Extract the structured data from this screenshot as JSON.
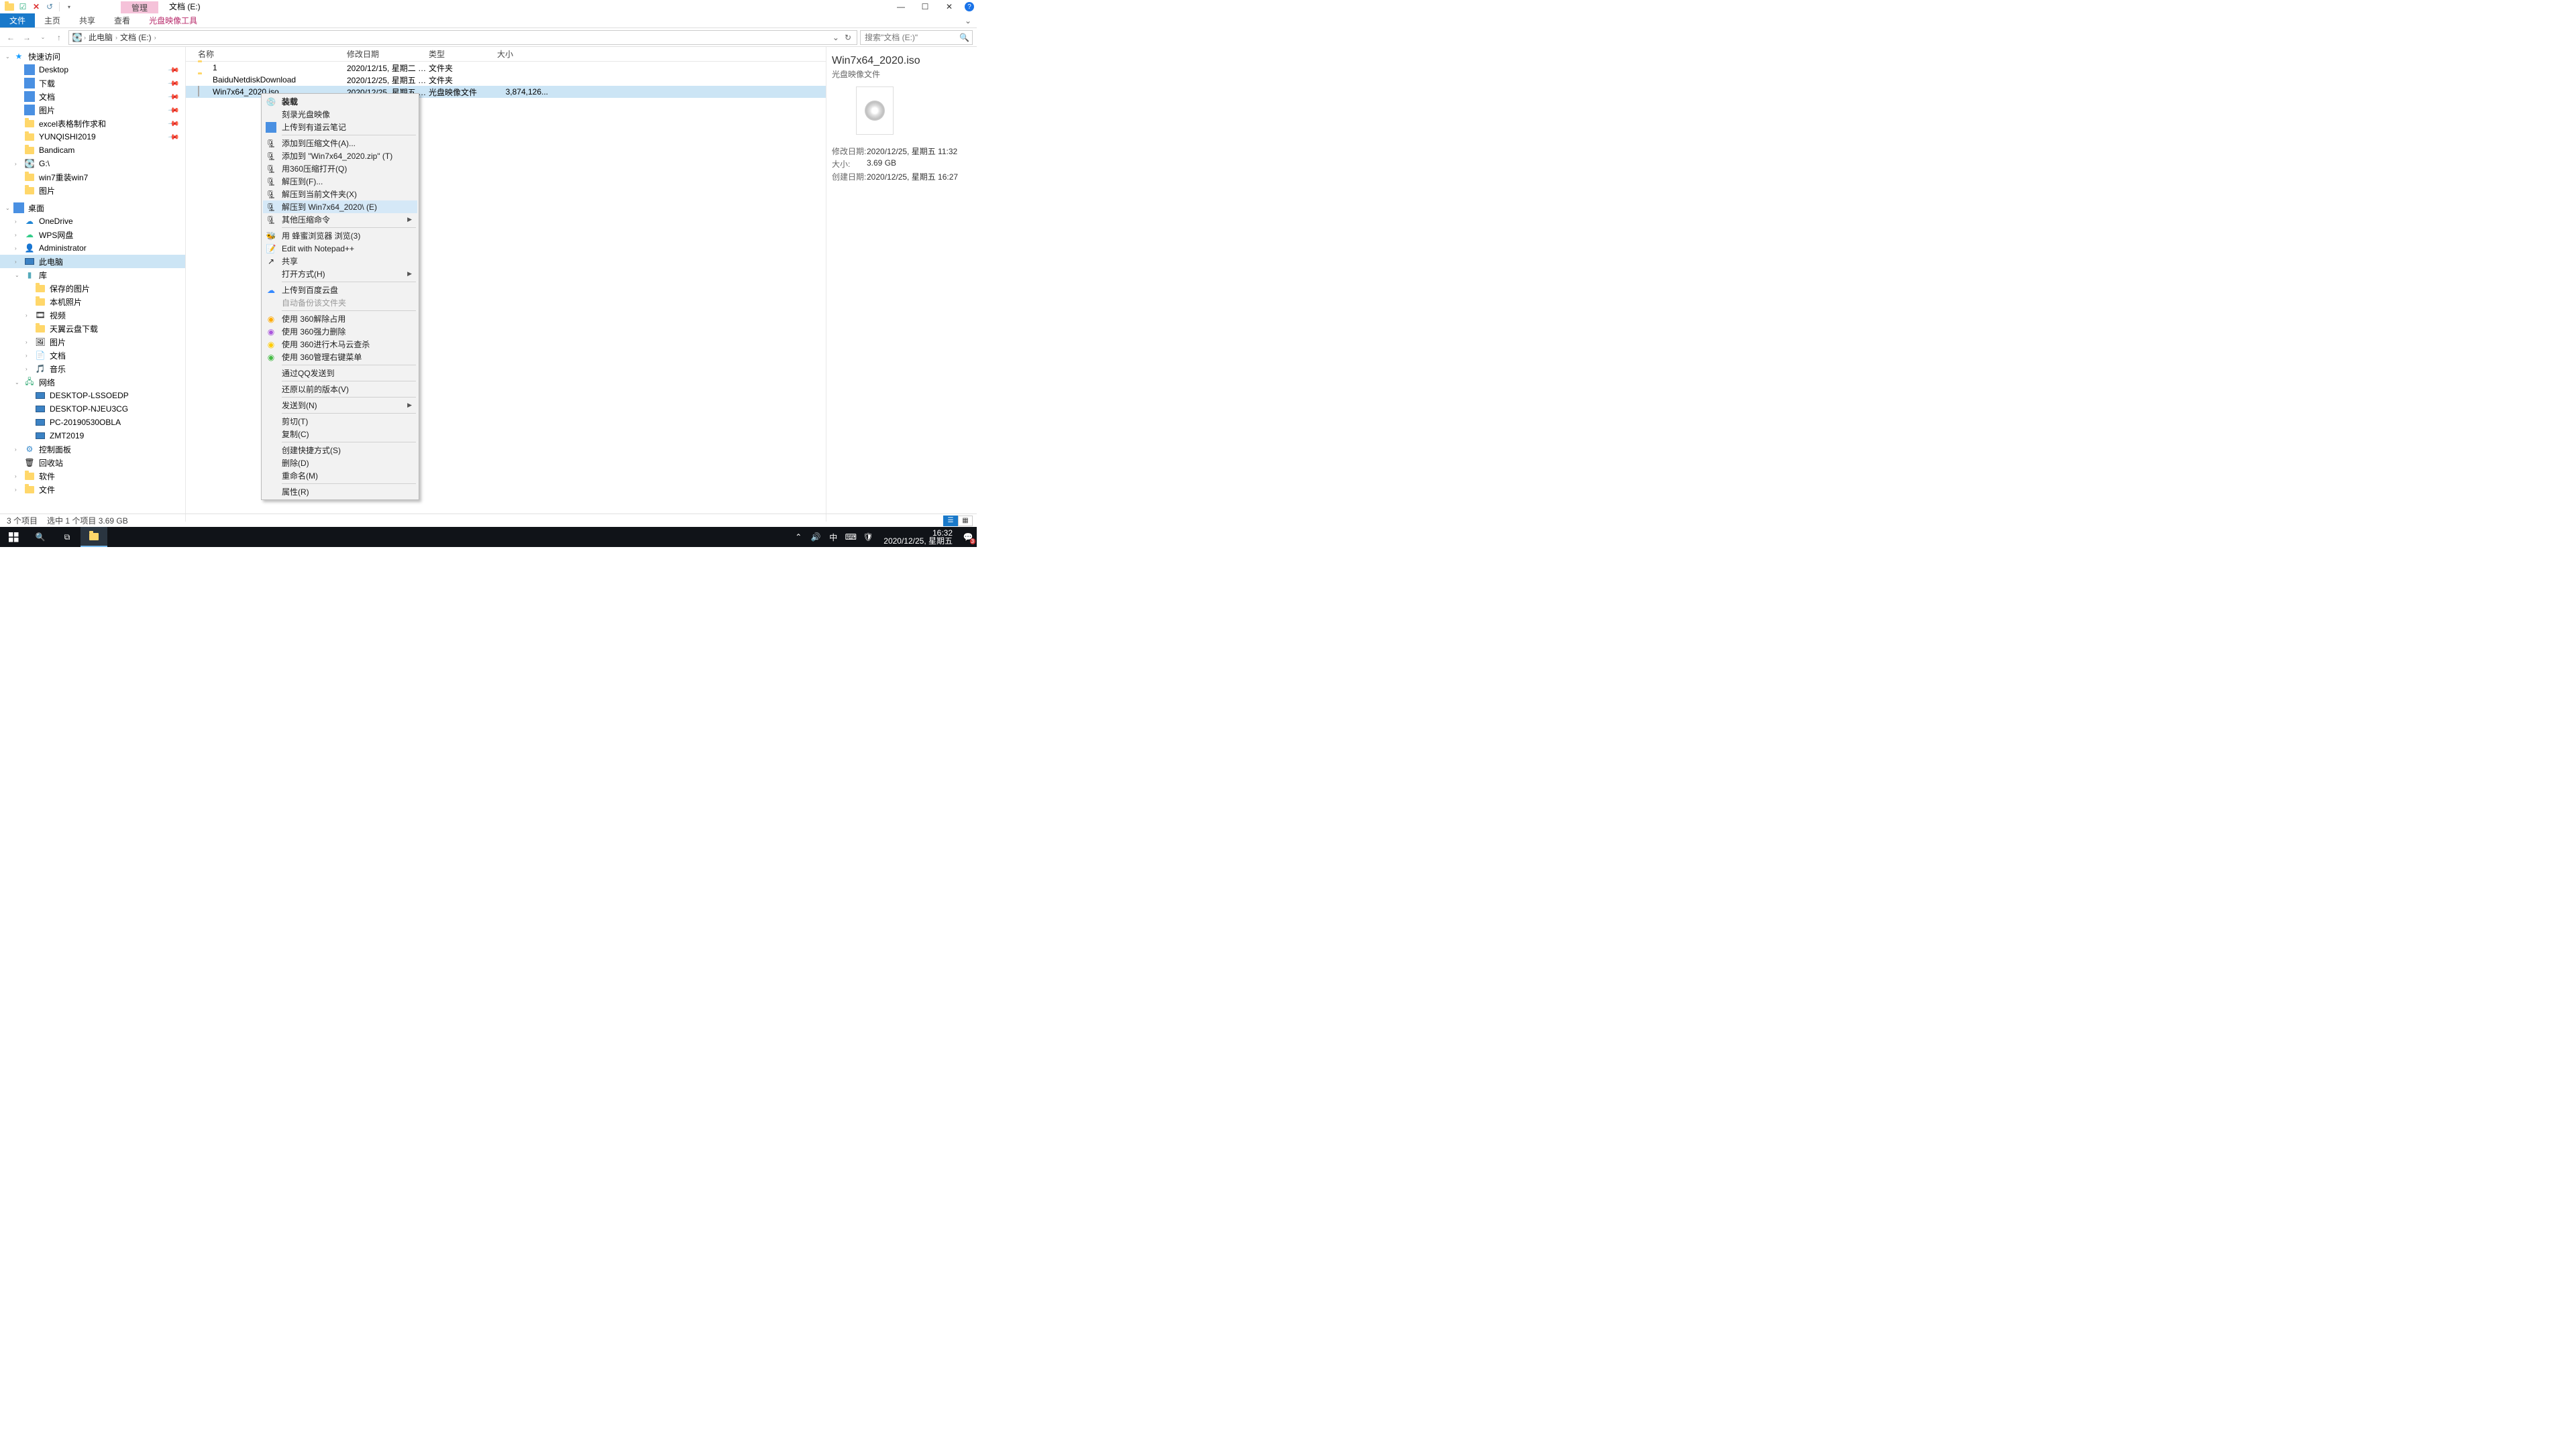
{
  "window": {
    "title": "文档 (E:)",
    "contextual": "管理"
  },
  "ribbon": {
    "file": "文件",
    "home": "主页",
    "share": "共享",
    "view": "查看",
    "context_tool": "光盘映像工具"
  },
  "address": {
    "root": "此电脑",
    "current": "文档 (E:)"
  },
  "search": {
    "placeholder": "搜索\"文档 (E:)\""
  },
  "tree": {
    "quick": "快速访问",
    "quick_items": [
      "Desktop",
      "下载",
      "文档",
      "图片",
      "excel表格制作求和",
      "YUNQISHI2019",
      "Bandicam",
      "G:\\",
      "win7重装win7",
      "图片"
    ],
    "desktop": "桌面",
    "desktop_items": [
      "OneDrive",
      "WPS网盘",
      "Administrator",
      "此电脑",
      "库"
    ],
    "lib_items": [
      "保存的图片",
      "本机照片",
      "视频",
      "天翼云盘下载",
      "图片",
      "文档",
      "音乐"
    ],
    "network": "网络",
    "net_items": [
      "DESKTOP-LSSOEDP",
      "DESKTOP-NJEU3CG",
      "PC-20190530OBLA",
      "ZMT2019"
    ],
    "misc": [
      "控制面板",
      "回收站",
      "软件",
      "文件"
    ]
  },
  "cols": {
    "name": "名称",
    "date": "修改日期",
    "type": "类型",
    "size": "大小"
  },
  "rows": [
    {
      "name": "1",
      "date": "2020/12/15, 星期二 1...",
      "type": "文件夹",
      "size": ""
    },
    {
      "name": "BaiduNetdiskDownload",
      "date": "2020/12/25, 星期五 1...",
      "type": "文件夹",
      "size": ""
    },
    {
      "name": "Win7x64_2020.iso",
      "date": "2020/12/25, 星期五 1...",
      "type": "光盘映像文件",
      "size": "3,874,126..."
    }
  ],
  "ctx": [
    "装载",
    "刻录光盘映像",
    "上传到有道云笔记",
    "添加到压缩文件(A)...",
    "添加到 \"Win7x64_2020.zip\" (T)",
    "用360压缩打开(Q)",
    "解压到(F)...",
    "解压到当前文件夹(X)",
    "解压到 Win7x64_2020\\ (E)",
    "其他压缩命令",
    "用 蜂蜜浏览器 浏览(3)",
    "Edit with Notepad++",
    "共享",
    "打开方式(H)",
    "上传到百度云盘",
    "自动备份该文件夹",
    "使用 360解除占用",
    "使用 360强力删除",
    "使用 360进行木马云查杀",
    "使用 360管理右键菜单",
    "通过QQ发送到",
    "还原以前的版本(V)",
    "发送到(N)",
    "剪切(T)",
    "复制(C)",
    "创建快捷方式(S)",
    "删除(D)",
    "重命名(M)",
    "属性(R)"
  ],
  "preview": {
    "title": "Win7x64_2020.iso",
    "subtitle": "光盘映像文件",
    "mod_label": "修改日期:",
    "mod": "2020/12/25, 星期五 11:32",
    "size_label": "大小:",
    "size": "3.69 GB",
    "cre_label": "创建日期:",
    "cre": "2020/12/25, 星期五 16:27"
  },
  "status": {
    "count": "3 个项目",
    "sel": "选中 1 个项目  3.69 GB"
  },
  "taskbar": {
    "ime": "中",
    "time": "16:32",
    "date": "2020/12/25, 星期五",
    "badge": "3"
  }
}
